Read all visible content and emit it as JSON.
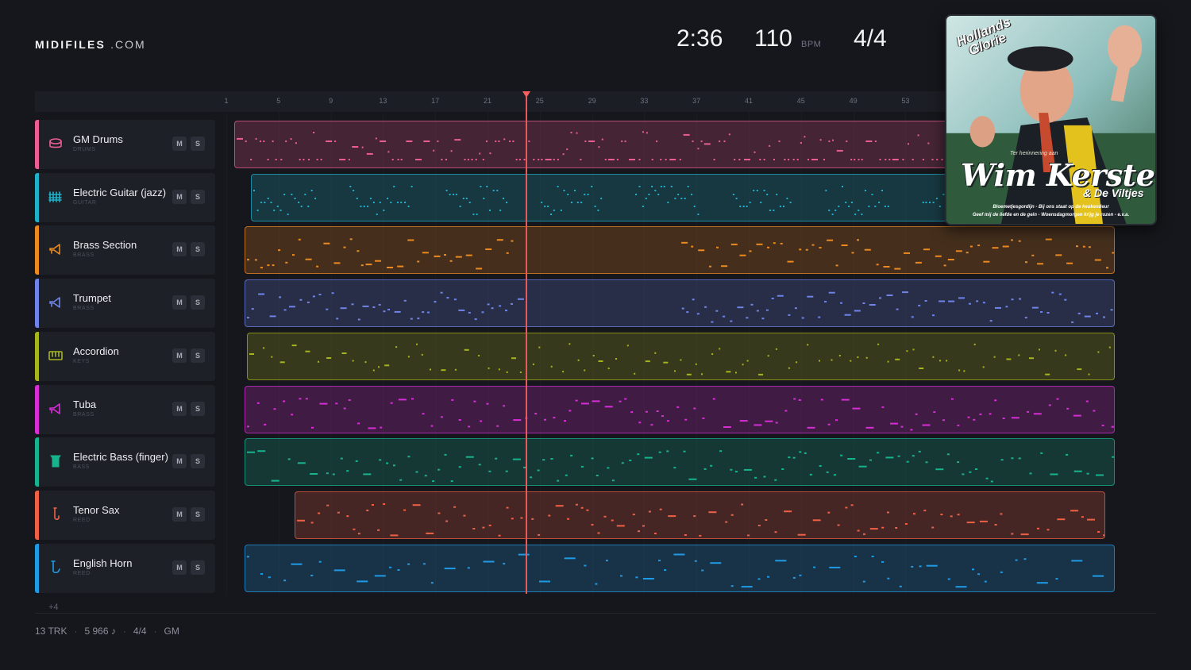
{
  "brand": {
    "main": "MIDIFILES",
    "sub": ".COM"
  },
  "stats": {
    "time": "2:36",
    "bpm": "110",
    "bpm_unit": "BPM",
    "time_signature": "4/4"
  },
  "ruler": {
    "ticks": [
      "1",
      "5",
      "9",
      "13",
      "17",
      "21",
      "25",
      "29",
      "33",
      "37",
      "41",
      "45",
      "49",
      "53"
    ]
  },
  "playhead_bar": 24,
  "tracks": [
    {
      "name": "GM Drums",
      "category": "DRUMS",
      "color": "#ec5d93",
      "icon": "drum-icon",
      "mute": "M",
      "solo": "S"
    },
    {
      "name": "Electric Guitar (jazz)",
      "category": "GUITAR",
      "color": "#1fb1c9",
      "icon": "guitar-icon",
      "mute": "M",
      "solo": "S"
    },
    {
      "name": "Brass Section",
      "category": "BRASS",
      "color": "#ec8a22",
      "icon": "horn-icon",
      "mute": "M",
      "solo": "S"
    },
    {
      "name": "Trumpet",
      "category": "BRASS",
      "color": "#6f84e8",
      "icon": "horn-icon",
      "mute": "M",
      "solo": "S"
    },
    {
      "name": "Accordion",
      "category": "KEYS",
      "color": "#a7b51d",
      "icon": "keys-icon",
      "mute": "M",
      "solo": "S"
    },
    {
      "name": "Tuba",
      "category": "BRASS",
      "color": "#d72ed6",
      "icon": "horn-icon",
      "mute": "M",
      "solo": "S"
    },
    {
      "name": "Electric Bass (finger)",
      "category": "BASS",
      "color": "#17b38e",
      "icon": "bass-icon",
      "mute": "M",
      "solo": "S"
    },
    {
      "name": "Tenor Sax",
      "category": "REED",
      "color": "#ef6146",
      "icon": "sax-icon",
      "mute": "M",
      "solo": "S"
    },
    {
      "name": "English Horn",
      "category": "REED",
      "color": "#1f9be6",
      "icon": "reed-icon",
      "mute": "M",
      "solo": "S"
    }
  ],
  "more_tracks": "+4",
  "footer": {
    "tracks": "13 TRK",
    "notes": "5 966 ♪",
    "signature": "4/4",
    "standard": "GM"
  },
  "album": {
    "brand_line1": "Hollands",
    "brand_line2": "Glorie",
    "dedication": "Ter herinnering aan",
    "artist": "Wim Kersten",
    "band": "& De Viltjes",
    "songs_line1": "Bloemetjesgordijn - Bij ons staat op de keukendeur",
    "songs_line2": "Geef mij de liefde en de gein - Woensdagmorgen krijg je rozen - e.v.a."
  }
}
